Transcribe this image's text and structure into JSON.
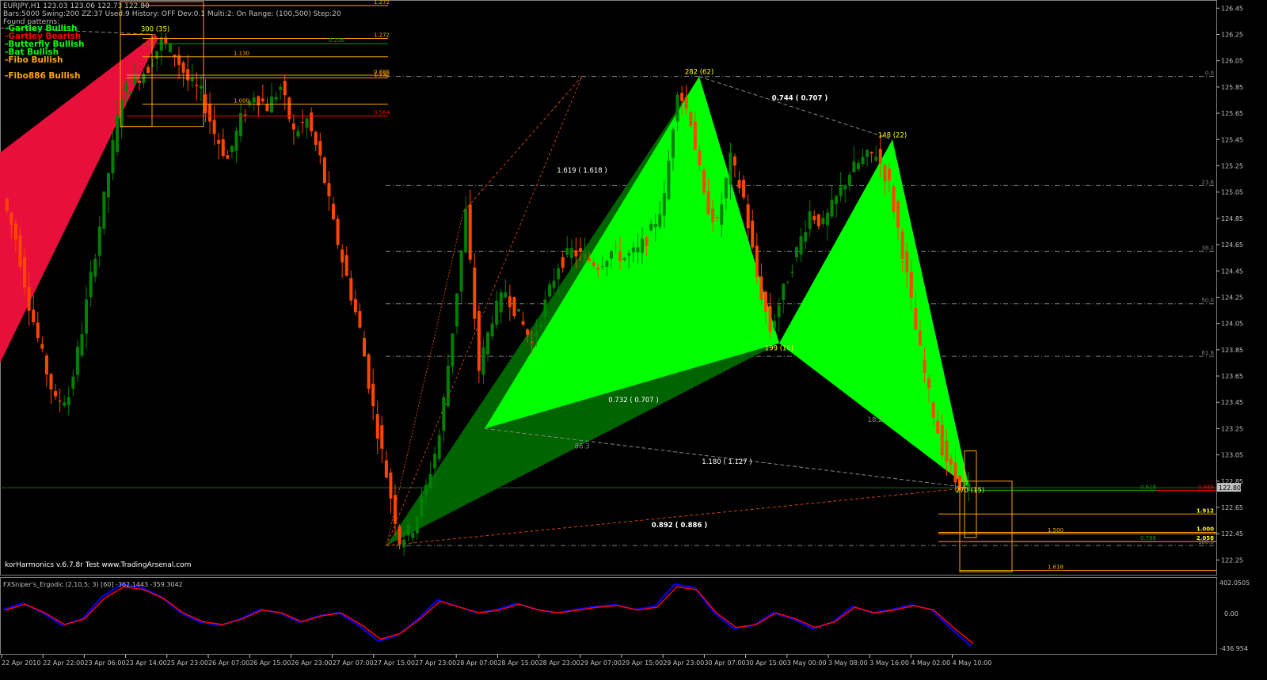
{
  "window": {
    "symbol_line": "EURJPY,H1  123.03 123.06 122.73 122.80",
    "settings_line": "Bars:5000  Swing:200  ZZ:37  Used:9  History: OFF Dev:0.1  Multi:2: On  Range: (100,500)  Step:20",
    "found_label": "Found patterns:"
  },
  "patterns": [
    {
      "label": "-Gartley Bullish",
      "color": "#00ff00"
    },
    {
      "label": "-Gartley Bearish",
      "color": "#ff0000"
    },
    {
      "label": "-Butterfly Bullish",
      "color": "#00ff00"
    },
    {
      "label": "-Bat Bullish",
      "color": "#00ff00"
    },
    {
      "label": "-Fibo Bullish",
      "color": "#ffa500"
    },
    {
      "label": "-Fibo886 Bullish",
      "color": "#ffa500"
    }
  ],
  "watermark": "korHarmonics v.6.7.8r Test www.TradingArsenal.com",
  "oscillator": {
    "label": "FXSniper's_Ergodic (2,10,5; 3) [60] -362.1443 -359.3042",
    "scale": [
      "402.0505",
      "0.00",
      "-436.954"
    ]
  },
  "chart_data": {
    "type": "candlestick",
    "symbol": "EURJPY",
    "timeframe": "H1",
    "ohlc_current": {
      "open": 123.03,
      "high": 123.06,
      "low": 122.73,
      "close": 122.8
    },
    "ylim": [
      122.15,
      126.5
    ],
    "y_ticks": [
      126.45,
      126.25,
      126.05,
      125.85,
      125.65,
      125.45,
      125.25,
      125.05,
      124.85,
      124.65,
      124.45,
      124.25,
      124.05,
      123.85,
      123.65,
      123.45,
      123.25,
      123.05,
      122.85,
      122.65,
      122.45,
      122.25
    ],
    "current_price_tag": "122.80",
    "x_labels": [
      "22 Apr 2010",
      "22 Apr 22:00",
      "23 Apr 06:00",
      "23 Apr 14:00",
      "25 Apr 23:00",
      "26 Apr 07:00",
      "26 Apr 15:00",
      "26 Apr 23:00",
      "27 Apr 07:00",
      "27 Apr 15:00",
      "27 Apr 23:00",
      "28 Apr 07:00",
      "28 Apr 15:00",
      "28 Apr 23:00",
      "29 Apr 07:00",
      "29 Apr 15:00",
      "29 Apr 23:00",
      "30 Apr 07:00",
      "30 Apr 15:00",
      "3 May 00:00",
      "3 May 08:00",
      "3 May 16:00",
      "4 May 02:00",
      "4 May 10:00"
    ],
    "close_path": [
      125.0,
      124.7,
      124.2,
      123.8,
      123.45,
      123.5,
      124.0,
      124.6,
      125.2,
      125.8,
      125.9,
      126.0,
      126.2,
      126.1,
      125.9,
      125.8,
      125.5,
      125.3,
      125.6,
      125.8,
      125.7,
      125.85,
      125.5,
      125.6,
      125.3,
      124.8,
      124.4,
      124.0,
      123.4,
      122.9,
      122.4,
      122.5,
      122.8,
      123.2,
      124.0,
      124.9,
      123.7,
      124.1,
      124.3,
      124.1,
      123.9,
      124.2,
      124.5,
      124.6,
      124.55,
      124.5,
      124.6,
      124.55,
      124.6,
      124.75,
      125.0,
      125.85,
      125.6,
      125.0,
      124.8,
      125.3,
      125.0,
      124.4,
      124.0,
      124.3,
      124.6,
      124.9,
      124.8,
      125.0,
      125.2,
      125.3,
      125.35,
      125.1,
      124.6,
      124.0,
      123.5,
      123.1,
      122.85,
      122.8
    ],
    "bullish_color": "#008000",
    "bearish_color": "#ff4500",
    "pattern_points": [
      {
        "label": "300 (35)",
        "price": 126.25
      },
      {
        "label": "282 (62)",
        "price": 125.93
      },
      {
        "label": "148 (22)",
        "price": 125.47
      },
      {
        "label": "199 (16)",
        "price": 123.92
      },
      {
        "label": "270 (15)",
        "price": 122.82
      }
    ],
    "ratio_labels": [
      "1.619 ( 1.618 )",
      "0.744 ( 0.707 )",
      "0.732 ( 0.707 )",
      "1.180 ( 1.127 )",
      "0.892 ( 0.886 )",
      "18.2",
      "86.3"
    ],
    "fib_levels": [
      {
        "label": "0.0",
        "price": 125.93
      },
      {
        "label": "23.6",
        "price": 125.1
      },
      {
        "label": "38.2",
        "price": 124.6
      },
      {
        "label": "50.0",
        "price": 124.2
      },
      {
        "label": "61.8",
        "price": 123.8
      },
      {
        "label": "100.0",
        "price": 122.36
      }
    ],
    "target_levels_top": [
      {
        "label": "1.272",
        "price": 126.47
      },
      {
        "label": "1.272",
        "price": 126.22
      },
      {
        "label": "0.236",
        "price": 126.18
      },
      {
        "label": "1.130",
        "price": 126.08
      },
      {
        "label": "0.886",
        "price": 125.94
      },
      {
        "label": "1.130",
        "price": 125.92
      },
      {
        "label": "1.000",
        "price": 125.72
      },
      {
        "label": "0.564",
        "price": 125.63
      }
    ],
    "target_levels_bottom": [
      {
        "label": "0.886",
        "price": 122.78
      },
      {
        "label": "0.618",
        "price": 122.78
      },
      {
        "label": "1.912",
        "price": 122.6
      },
      {
        "label": "1.000",
        "price": 122.46
      },
      {
        "label": "1.500",
        "price": 122.45
      },
      {
        "label": "0.786",
        "price": 122.39
      },
      {
        "label": "2.058",
        "price": 122.39
      },
      {
        "label": "1.618",
        "price": 122.17
      }
    ],
    "colors": {
      "pattern_fill": "#00ff00",
      "pattern_shadow": "#006400",
      "bearish_fill": "#e8103a",
      "fib_line": "#808080",
      "target_line": "#ffa500",
      "red_line": "#ff0000",
      "axis_text": "#c0c0c0",
      "osc_line_a": "#0000ff",
      "osc_line_b": "#ff0000"
    }
  }
}
